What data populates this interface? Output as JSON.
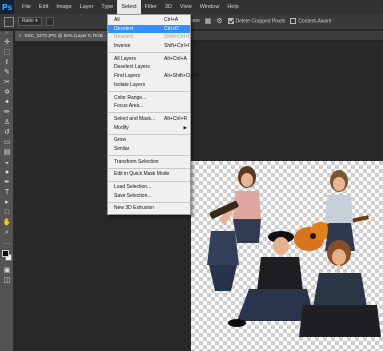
{
  "menubar": {
    "logo": "Ps",
    "items": [
      "File",
      "Edit",
      "Image",
      "Layer",
      "Type",
      "Select",
      "Filter",
      "3D",
      "View",
      "Window",
      "Help"
    ],
    "active_index": 5
  },
  "options_bar": {
    "ratio_label": "Ratio",
    "right_items": {
      "straighten_fragment": "ighten",
      "delete_cropped_label": "Delete Cropped Pixels",
      "content_aware_label": "Content-Aware",
      "delete_cropped_checked": true,
      "content_aware_checked": false
    }
  },
  "document": {
    "tab_title": "DSC_5273.JPG @ 50% (Layer 0, RGB"
  },
  "select_menu": {
    "sections": [
      [
        {
          "label": "All",
          "shortcut": "Ctrl+A",
          "disabled": false
        },
        {
          "label": "Deselect",
          "shortcut": "Ctrl+D",
          "disabled": false,
          "highlighted": true
        },
        {
          "label": "Reselect",
          "shortcut": "Shift+Ctrl+D",
          "disabled": true
        },
        {
          "label": "Inverse",
          "shortcut": "Shift+Ctrl+I",
          "disabled": false
        }
      ],
      [
        {
          "label": "All Layers",
          "shortcut": "Alt+Ctrl+A",
          "disabled": false
        },
        {
          "label": "Deselect Layers",
          "shortcut": "",
          "disabled": false
        },
        {
          "label": "Find Layers",
          "shortcut": "Alt+Shift+Ctrl+F",
          "disabled": false
        },
        {
          "label": "Isolate Layers",
          "shortcut": "",
          "disabled": false
        }
      ],
      [
        {
          "label": "Color Range...",
          "shortcut": "",
          "disabled": false
        },
        {
          "label": "Focus Area...",
          "shortcut": "",
          "disabled": false
        }
      ],
      [
        {
          "label": "Select and Mask...",
          "shortcut": "Alt+Ctrl+R",
          "disabled": false
        },
        {
          "label": "Modify",
          "shortcut": "",
          "disabled": false,
          "submenu": true
        }
      ],
      [
        {
          "label": "Grow",
          "shortcut": "",
          "disabled": false
        },
        {
          "label": "Similar",
          "shortcut": "",
          "disabled": false
        }
      ],
      [
        {
          "label": "Transform Selection",
          "shortcut": "",
          "disabled": false
        }
      ],
      [
        {
          "label": "Edit in Quick Mask Mode",
          "shortcut": "",
          "disabled": false
        }
      ],
      [
        {
          "label": "Load Selection...",
          "shortcut": "",
          "disabled": false
        },
        {
          "label": "Save Selection...",
          "shortcut": "",
          "disabled": false
        }
      ],
      [
        {
          "label": "New 3D Extrusion",
          "shortcut": "",
          "disabled": false
        }
      ]
    ]
  },
  "toolbar": {
    "tools": [
      "move-tool",
      "marquee-tool",
      "lasso-tool",
      "quick-selection-tool",
      "crop-tool",
      "eyedropper-tool",
      "spot-healing-tool",
      "brush-tool",
      "clone-stamp-tool",
      "history-brush-tool",
      "eraser-tool",
      "gradient-tool",
      "blur-tool",
      "dodge-tool",
      "pen-tool",
      "type-tool",
      "path-selection-tool",
      "rectangle-tool",
      "hand-tool",
      "zoom-tool",
      "more-tools"
    ],
    "foreground_color": "#0a0a0a",
    "background_color": "#fafafa"
  },
  "colors": {
    "app_background": "#282828",
    "menu_highlight": "#3390ff",
    "ps_logo_blue": "#31a8ff"
  }
}
